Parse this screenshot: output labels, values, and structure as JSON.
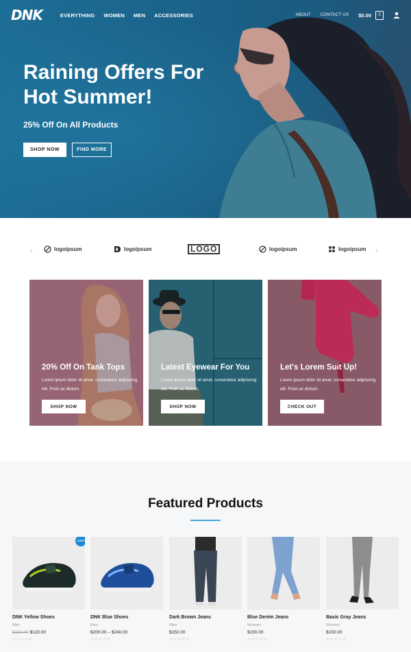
{
  "nav": {
    "logo": "DNK",
    "links": [
      "EVERYTHING",
      "WOMEN",
      "MEN",
      "ACCESSORIES"
    ],
    "about": "ABOUT",
    "contact": "CONTACT US",
    "cart_total": "$0.00",
    "cart_count": "0"
  },
  "hero": {
    "title": "Raining Offers For Hot Summer!",
    "subtitle": "25% Off On All Products",
    "shop_button": "SHOP NOW",
    "find_button": "FIND MORE"
  },
  "logos": [
    "logoipsum",
    "logoipsum",
    "LOGO",
    "logoipsum",
    "logoipsum"
  ],
  "cards": [
    {
      "title": "20% Off On Tank Tops",
      "text": "Lorem ipsum dolor sit amet, consectetur adipiscing elit. Proin ac dictum.",
      "button": "SHOP NOW"
    },
    {
      "title": "Latest Eyewear For You",
      "text": "Lorem ipsum dolor sit amet, consectetur adipiscing elit. Proin ac dictum.",
      "button": "SHOP NOW"
    },
    {
      "title": "Let's Lorem Suit Up!",
      "text": "Lorem ipsum dolor sit amet, consectetur adipiscing elit. Proin ac dictum.",
      "button": "CHECK OUT"
    }
  ],
  "featured": {
    "title": "Featured Products",
    "sale_badge": "Sale!",
    "products": [
      {
        "name": "DNK Yellow Shoes",
        "category": "Men",
        "old_price": "$150.00",
        "price": "$120.00"
      },
      {
        "name": "DNK Blue Shoes",
        "category": "Men",
        "price": "$200.00 – $240.00"
      },
      {
        "name": "Dark Brown Jeans",
        "category": "Men",
        "price": "$150.00"
      },
      {
        "name": "Blue Denim Jeans",
        "category": "Women",
        "price": "$150.00"
      },
      {
        "name": "Basic Gray Jeans",
        "category": "Women",
        "price": "$150.00"
      }
    ]
  },
  "colors": {
    "accent": "#41a9d8",
    "sale_badge": "#1e88d6",
    "hero_blue": "#1d6e96",
    "card_overlay": "#8e5f6e"
  }
}
